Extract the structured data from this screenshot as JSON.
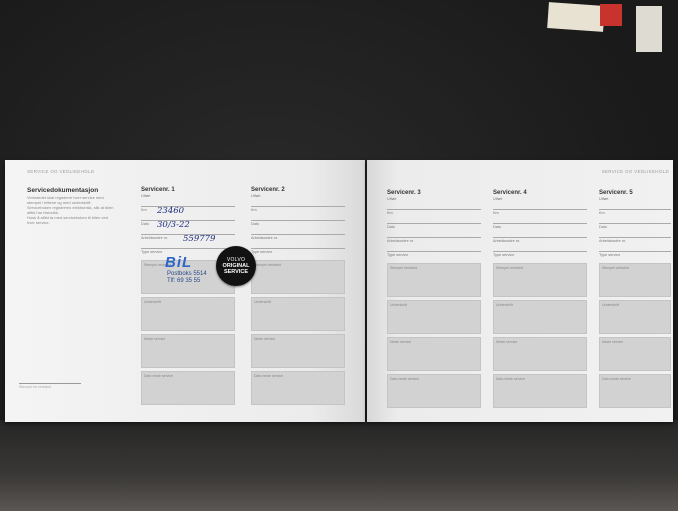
{
  "header": {
    "left": "SERVICE OG VEDLIKEHOLD",
    "right": "SERVICE OG VEDLIKEHOLD"
  },
  "intro": {
    "title": "Servicedokumentasjon",
    "lines": [
      "Verkstedet skal registrere hver service med",
      "stempel i feltene og med underskrift.",
      "Serviceboken registreres elektronisk, slik at bilen",
      "alltid har historikk.",
      "Husk å alltid ta med serviceboken til bilen ved",
      "hver service."
    ],
    "signature_label": "Stempel fra verksted"
  },
  "labels": {
    "utfort": "Utført",
    "km": "Km",
    "dato": "Dato",
    "arbeidsordre": "Arbeidsordre nr.",
    "type": "Type service",
    "stempel": "Stempel verksted",
    "underskrift": "Underskrift",
    "neste": "Neste service",
    "dato_neste": "Dato neste service"
  },
  "services": [
    {
      "title": "Servicenr. 1",
      "km": "23460",
      "dato": "30/3-22",
      "arbeidsordre": "559779"
    },
    {
      "title": "Servicenr. 2",
      "km": "",
      "dato": "",
      "arbeidsordre": ""
    },
    {
      "title": "Servicenr. 3",
      "km": "",
      "dato": "",
      "arbeidsordre": ""
    },
    {
      "title": "Servicenr. 4",
      "km": "",
      "dato": "",
      "arbeidsordre": ""
    },
    {
      "title": "Servicenr. 5",
      "km": "",
      "dato": "",
      "arbeidsordre": ""
    }
  ],
  "stamp": {
    "logo": "BiL",
    "line1": "Postboks 5514",
    "line2": "Tlf: 69 35 55"
  },
  "sticker": {
    "line1": "VOLVO",
    "line2": "ORIGINAL",
    "line3": "SERVICE"
  },
  "colors": {
    "stamp_blue": "#2c66c9",
    "ink_blue": "#1b2b7a",
    "sticker_black": "#121212"
  }
}
